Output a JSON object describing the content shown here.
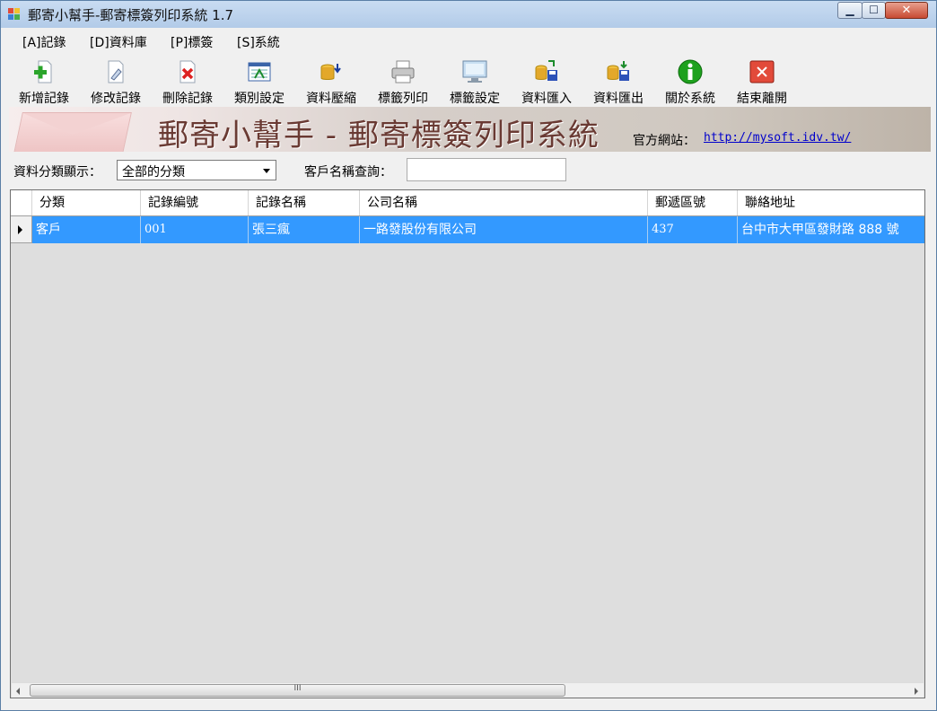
{
  "window": {
    "title": "郵寄小幫手-郵寄標簽列印系統 1.7"
  },
  "menu": [
    {
      "label": "[A]記錄",
      "icon": null
    },
    {
      "label": "[D]資料庫"
    },
    {
      "label": "[P]標簽"
    },
    {
      "label": "[S]系統"
    }
  ],
  "toolbar": [
    {
      "label": "新增記錄",
      "icon": "add-icon"
    },
    {
      "label": "修改記錄",
      "icon": "edit-icon"
    },
    {
      "label": "刪除記錄",
      "icon": "delete-icon"
    },
    {
      "label": "類別設定",
      "icon": "category-icon"
    },
    {
      "label": "資料壓縮",
      "icon": "compress-icon"
    },
    {
      "label": "標籤列印",
      "icon": "printer-icon"
    },
    {
      "label": "標籤設定",
      "icon": "monitor-icon"
    },
    {
      "label": "資料匯入",
      "icon": "import-icon"
    },
    {
      "label": "資料匯出",
      "icon": "export-icon"
    },
    {
      "label": "關於系統",
      "icon": "info-icon"
    },
    {
      "label": "結束離開",
      "icon": "exit-icon"
    }
  ],
  "banner": {
    "title": "郵寄小幫手 - 郵寄標簽列印系統",
    "site_label": "官方網站：",
    "site_url": "http://mysoft.idv.tw/"
  },
  "filter": {
    "category_label": "資料分類顯示：",
    "category_value": "全部的分類",
    "search_label": "客戶名稱查詢：",
    "search_value": ""
  },
  "grid": {
    "columns": [
      "分類",
      "記錄編號",
      "記錄名稱",
      "公司名稱",
      "郵遞區號",
      "聯絡地址"
    ],
    "rows": [
      [
        "客戶",
        "001",
        "張三瘋",
        "一路發股份有限公司",
        "437",
        "台中市大甲區發財路 888 號"
      ]
    ],
    "selected_row": 0
  },
  "colors": {
    "selection": "#3399ff",
    "link": "#0000cc"
  }
}
